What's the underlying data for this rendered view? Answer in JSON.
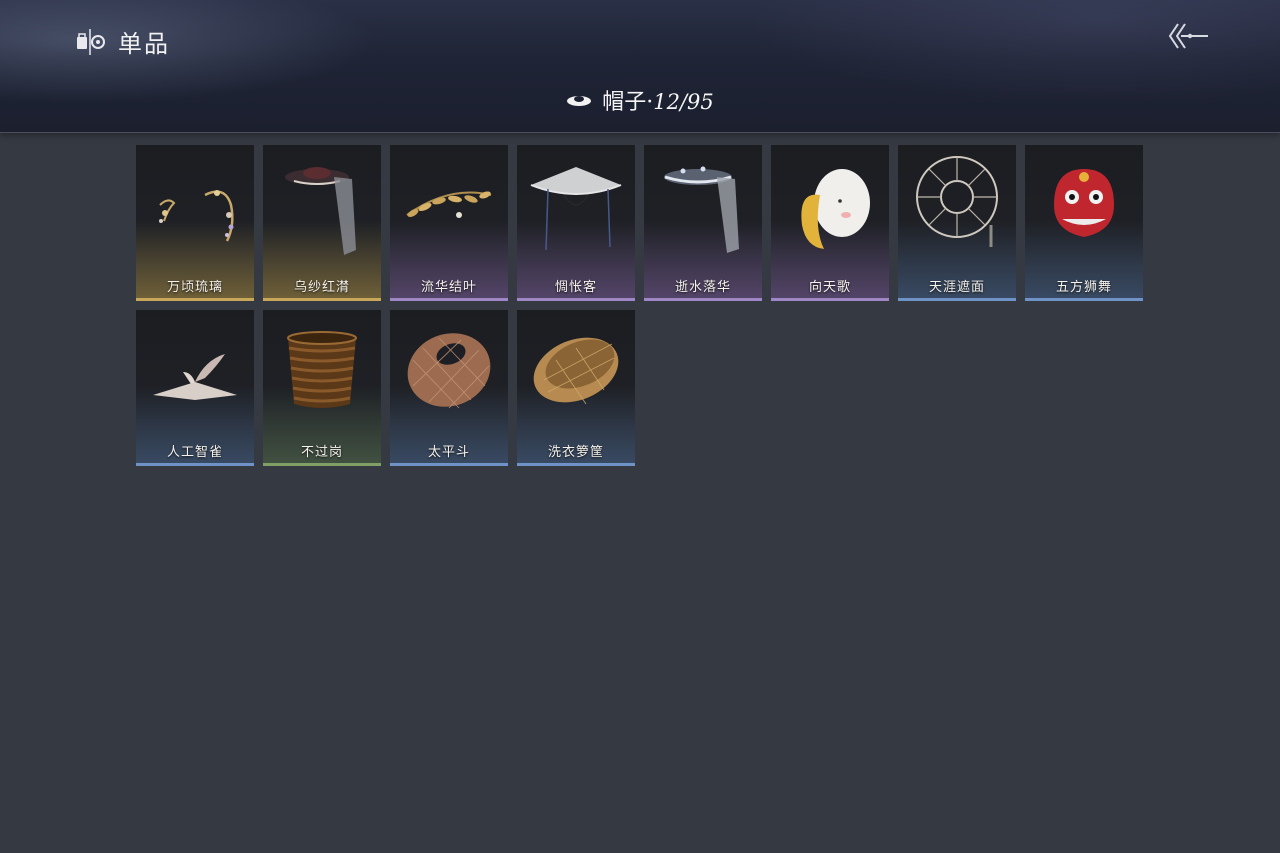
{
  "header": {
    "section_label": "单品",
    "section_icon": "wardrobe-icon",
    "back_icon": "back-arrow-icon"
  },
  "category": {
    "icon": "hat-icon",
    "name": "帽子·",
    "collected": "12",
    "total": "95",
    "count_text": "12/95"
  },
  "quality_colors": {
    "gold": "#c9a75a",
    "purple": "#9f86c4",
    "blue": "#6f93c6",
    "green": "#7f9f66"
  },
  "items": [
    {
      "name": "万顷琉璃",
      "quality": "gold",
      "icon": "hairpin-ornament-icon"
    },
    {
      "name": "乌纱红潸",
      "quality": "gold",
      "icon": "veiled-hat-icon"
    },
    {
      "name": "流华结叶",
      "quality": "purple",
      "icon": "leaf-circlet-icon"
    },
    {
      "name": "惆怅客",
      "quality": "purple",
      "icon": "wide-straw-hat-icon"
    },
    {
      "name": "逝水落华",
      "quality": "purple",
      "icon": "jeweled-veiled-hat-icon"
    },
    {
      "name": "向天歌",
      "quality": "purple",
      "icon": "goose-hood-icon"
    },
    {
      "name": "天涯遮面",
      "quality": "blue",
      "icon": "rattan-frame-hat-icon"
    },
    {
      "name": "五方狮舞",
      "quality": "blue",
      "icon": "lion-dance-head-icon"
    },
    {
      "name": "人工智雀",
      "quality": "blue",
      "icon": "bird-hat-icon"
    },
    {
      "name": "不过岗",
      "quality": "green",
      "icon": "stacked-bowls-icon"
    },
    {
      "name": "太平斗",
      "quality": "blue",
      "icon": "woven-basket-hat-icon"
    },
    {
      "name": "洗衣箩筐",
      "quality": "blue",
      "icon": "laundry-basket-icon"
    }
  ]
}
